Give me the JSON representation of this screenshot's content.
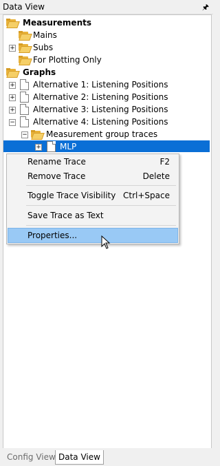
{
  "window": {
    "title": "Data View",
    "pin_icon": "pin-icon"
  },
  "tree": {
    "measurements": {
      "label": "Measurements",
      "children": [
        "Mains",
        "Subs",
        "For Plotting Only"
      ]
    },
    "graphs": {
      "label": "Graphs",
      "children": [
        "Alternative 1: Listening Positions",
        "Alternative 2: Listening Positions",
        "Alternative 3: Listening Positions",
        "Alternative 4: Listening Positions"
      ],
      "group": "Measurement group traces",
      "selected": "MLP"
    }
  },
  "context_menu": {
    "items": [
      {
        "label": "Rename Trace",
        "shortcut": "F2"
      },
      {
        "label": "Remove Trace",
        "shortcut": "Delete"
      },
      {
        "label": "Toggle Trace Visibility",
        "shortcut": "Ctrl+Space"
      },
      {
        "label": "Save Trace as Text",
        "shortcut": ""
      },
      {
        "label": "Properties...",
        "shortcut": ""
      }
    ],
    "hover_color": "#99c9f5"
  },
  "tabs": {
    "config": "Config View",
    "data": "Data View"
  },
  "colors": {
    "selection": "#0a6fd6",
    "folder": "#f5cf67"
  }
}
